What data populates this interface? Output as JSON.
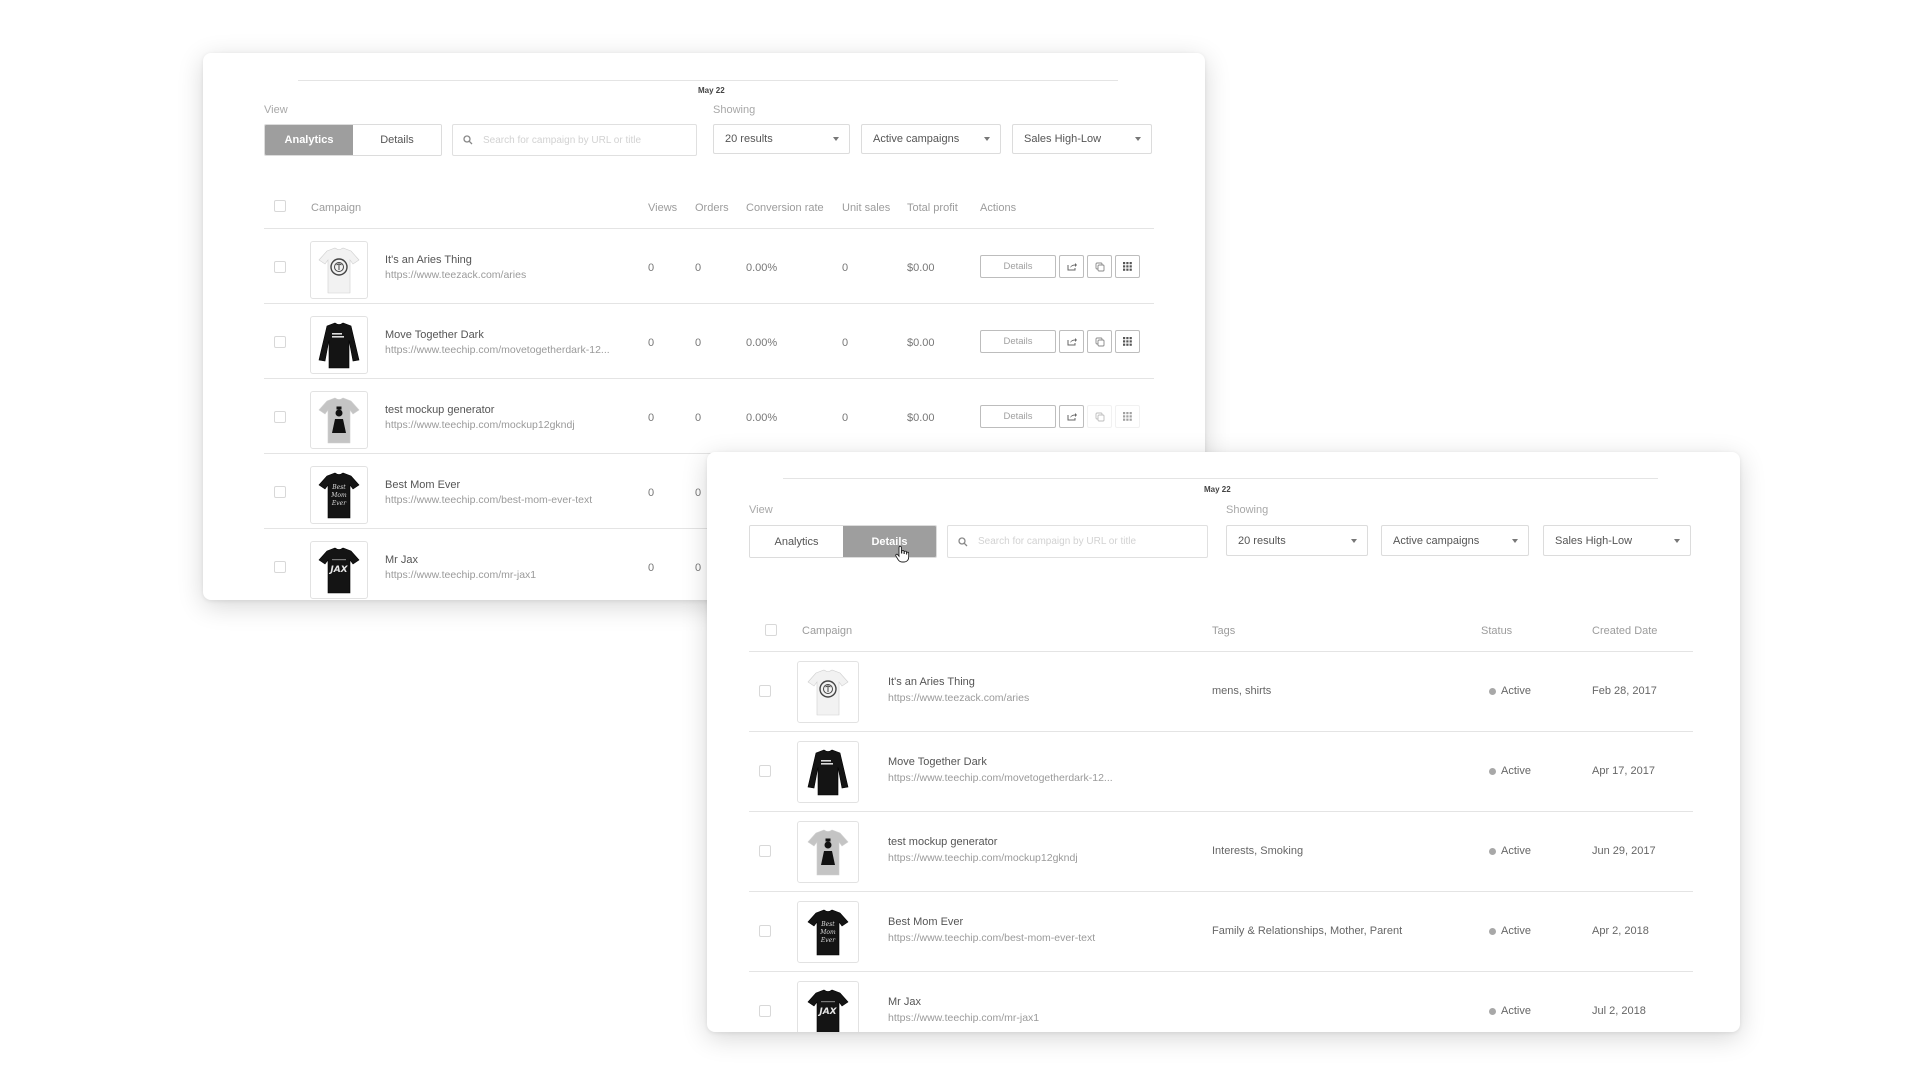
{
  "date_label": "May 22",
  "view_label": "View",
  "showing_label": "Showing",
  "toggle": {
    "analytics": "Analytics",
    "details": "Details"
  },
  "search": {
    "placeholder": "Search for campaign by URL or title",
    "value": ""
  },
  "filters": {
    "results": "20 results",
    "campaigns": "Active campaigns",
    "sort": "Sales High-Low"
  },
  "analytics_panel": {
    "active_view": "Analytics",
    "columns": {
      "campaign": "Campaign",
      "views": "Views",
      "orders": "Orders",
      "conversion": "Conversion rate",
      "unit_sales": "Unit sales",
      "profit": "Total profit",
      "actions": "Actions"
    },
    "details_button": "Details",
    "rows": [
      {
        "title": "It's an Aries Thing",
        "url": "https://www.teezack.com/aries",
        "views": "0",
        "orders": "0",
        "conversion": "0.00%",
        "unit_sales": "0",
        "profit": "$0.00",
        "thumb": "white-tee-aries",
        "copy_enabled": true
      },
      {
        "title": "Move Together Dark",
        "url": "https://www.teechip.com/movetogetherdark-12...",
        "views": "0",
        "orders": "0",
        "conversion": "0.00%",
        "unit_sales": "0",
        "profit": "$0.00",
        "thumb": "black-longsleeve",
        "copy_enabled": true
      },
      {
        "title": "test mockup generator",
        "url": "https://www.teechip.com/mockup12gkndj",
        "views": "0",
        "orders": "0",
        "conversion": "0.00%",
        "unit_sales": "0",
        "profit": "$0.00",
        "thumb": "gray-tee-portrait",
        "copy_enabled": false
      },
      {
        "title": "Best Mom Ever",
        "url": "https://www.teechip.com/best-mom-ever-text",
        "views": "0",
        "orders": "0",
        "thumb": "black-tee-bestmom"
      },
      {
        "title": "Mr Jax",
        "url": "https://www.teechip.com/mr-jax1",
        "views": "0",
        "orders": "0",
        "thumb": "black-tee-jax"
      }
    ]
  },
  "details_panel": {
    "active_view": "Details",
    "columns": {
      "campaign": "Campaign",
      "tags": "Tags",
      "status": "Status",
      "created": "Created Date"
    },
    "rows": [
      {
        "title": "It's an Aries Thing",
        "url": "https://www.teezack.com/aries",
        "tags": "mens,  shirts",
        "status": "Active",
        "created": "Feb 28, 2017",
        "thumb": "white-tee-aries"
      },
      {
        "title": "Move Together Dark",
        "url": "https://www.teechip.com/movetogetherdark-12...",
        "tags": "",
        "status": "Active",
        "created": "Apr 17, 2017",
        "thumb": "black-longsleeve"
      },
      {
        "title": "test mockup generator",
        "url": "https://www.teechip.com/mockup12gkndj",
        "tags": "Interests,  Smoking",
        "status": "Active",
        "created": "Jun 29, 2017",
        "thumb": "gray-tee-portrait"
      },
      {
        "title": "Best Mom Ever",
        "url": "https://www.teechip.com/best-mom-ever-text",
        "tags": "Family & Relationships,  Mother,  Parent",
        "status": "Active",
        "created": "Apr 2, 2018",
        "thumb": "black-tee-bestmom"
      },
      {
        "title": "Mr Jax",
        "url": "https://www.teechip.com/mr-jax1",
        "tags": "",
        "status": "Active",
        "created": "Jul 2, 2018",
        "thumb": "black-tee-jax"
      }
    ]
  },
  "colors": {
    "active_toggle": "#9e9e9e",
    "status_dot": "#a8a8a8",
    "rule": "#e4e4e4"
  }
}
